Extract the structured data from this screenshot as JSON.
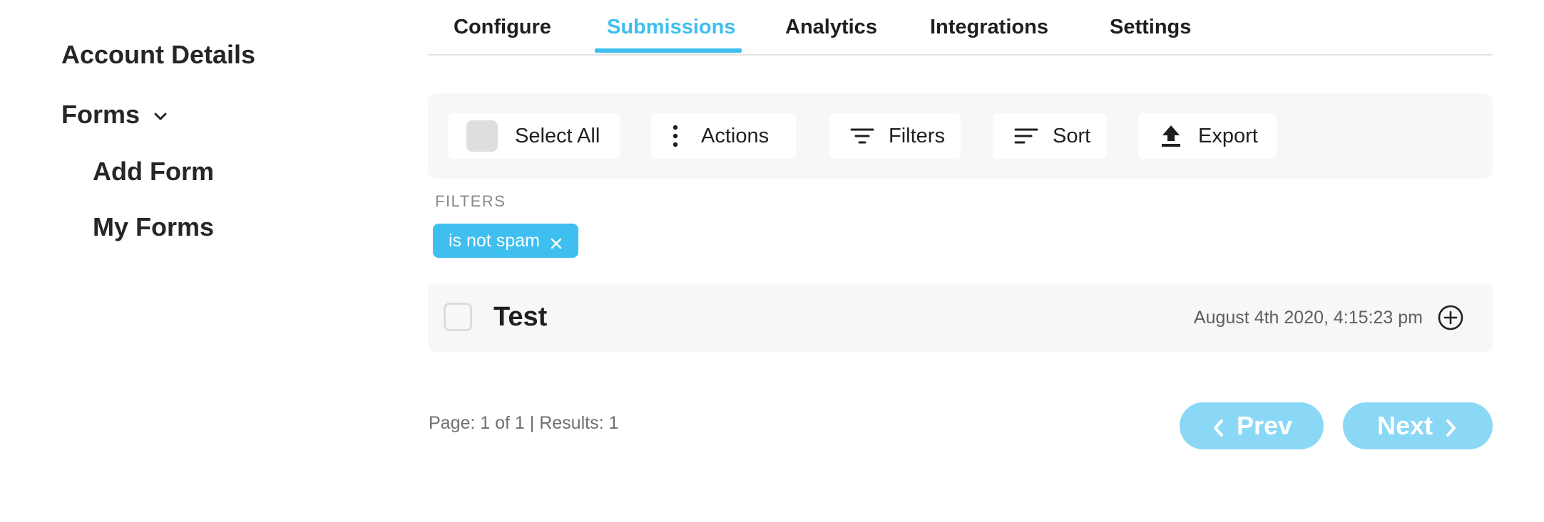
{
  "sidebar": {
    "account_details": "Account Details",
    "forms": "Forms",
    "forms_icon": "chevron-down-icon",
    "add_form": "Add Form",
    "my_forms": "My Forms"
  },
  "tabs": [
    {
      "label": "Configure",
      "active": false
    },
    {
      "label": "Submissions",
      "active": true
    },
    {
      "label": "Analytics",
      "active": false
    },
    {
      "label": "Integrations",
      "active": false
    },
    {
      "label": "Settings",
      "active": false
    }
  ],
  "toolbar": {
    "select_all": "Select All",
    "actions": "Actions",
    "actions_icon": "more-vertical-icon",
    "filters": "Filters",
    "filters_icon": "filter-icon",
    "sort": "Sort",
    "sort_icon": "sort-icon",
    "export": "Export",
    "export_icon": "upload-icon"
  },
  "filters": {
    "heading": "FILTERS",
    "chips": [
      {
        "label": "is not spam"
      }
    ]
  },
  "submissions": [
    {
      "title": "Test",
      "date": "August 4th 2020, 4:15:23 pm",
      "selected": false
    }
  ],
  "pagination": {
    "info": "Page: 1 of 1 | Results: 1",
    "prev": "Prev",
    "next": "Next"
  },
  "colors": {
    "accent": "#3ebfef",
    "pagination_button": "#8ad8f6",
    "panel_background": "#f7f7f7"
  }
}
